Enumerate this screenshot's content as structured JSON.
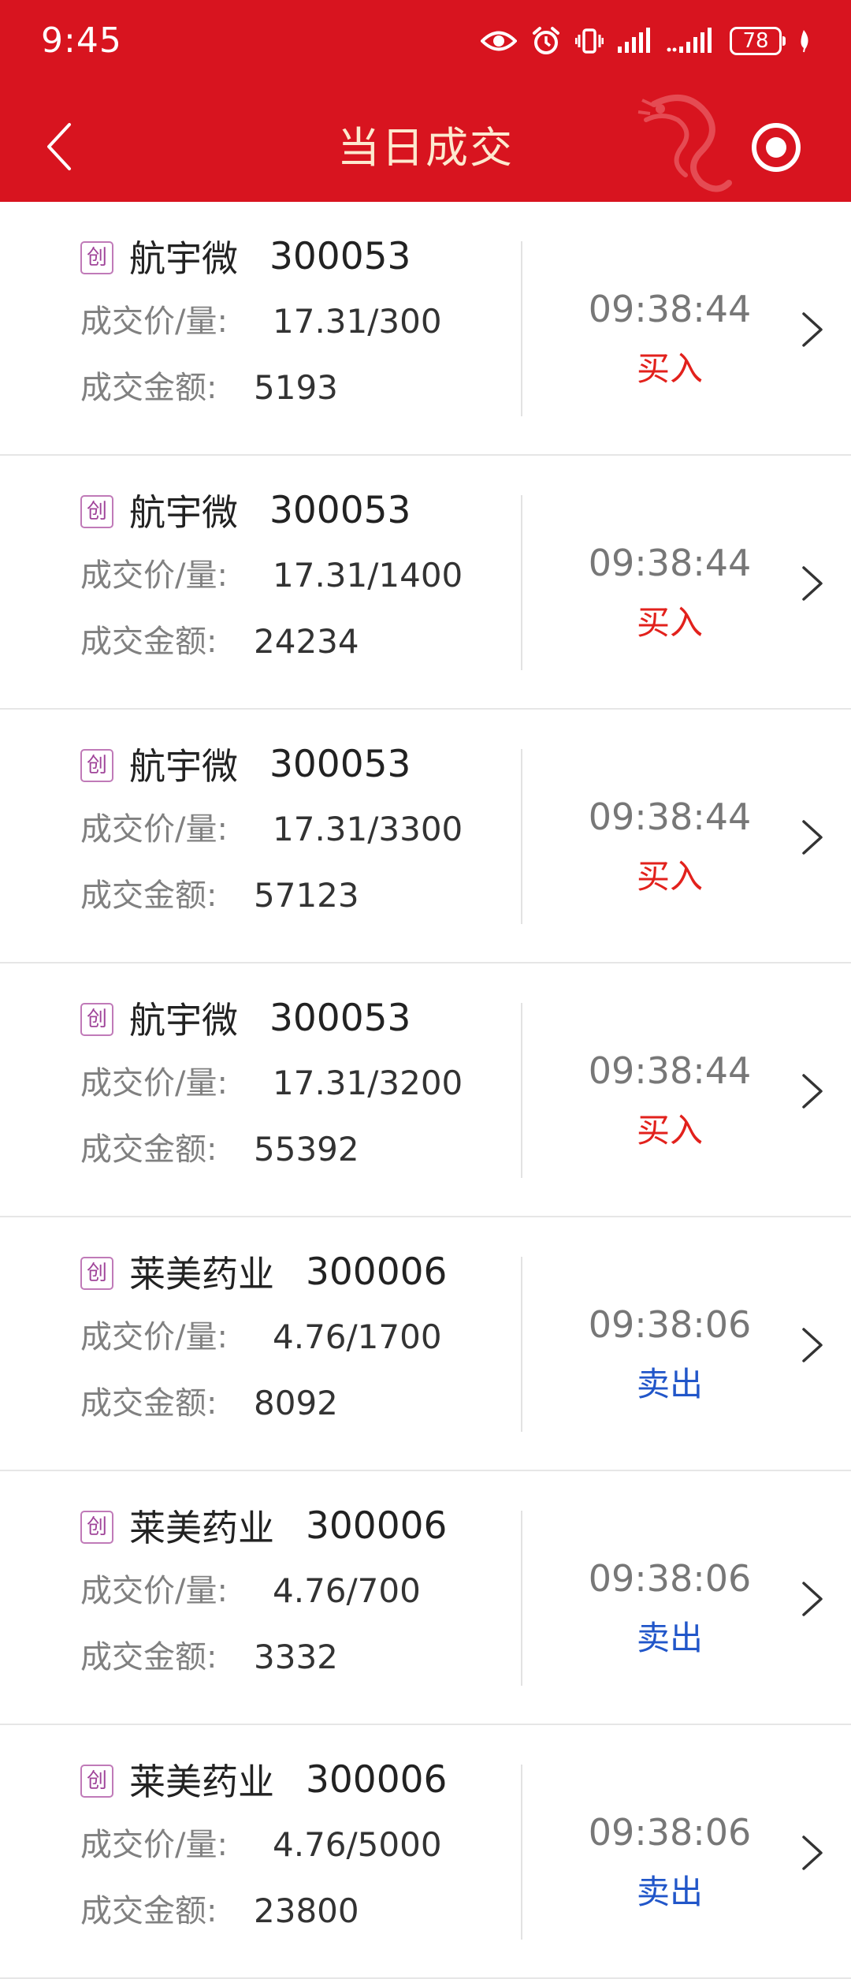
{
  "status_bar": {
    "time": "9:45",
    "battery": "78",
    "icons": [
      "eye-icon",
      "alarm-icon",
      "vibrate-icon",
      "signal-icon",
      "signal-icon",
      "battery-icon",
      "leaf-icon"
    ]
  },
  "header": {
    "title": "当日成交",
    "background_color": "#d8141f",
    "title_color": "#fde9cf"
  },
  "labels": {
    "price_qty": "成交价/量:",
    "amount": "成交金额:"
  },
  "colors": {
    "buy": "#e2211c",
    "sell": "#2156c9"
  },
  "trades": [
    {
      "badge": "创",
      "name": "航宇微",
      "code": "300053",
      "price_qty": "17.31/300",
      "amount": "5193",
      "time": "09:38:44",
      "side": "买入",
      "side_type": "buy"
    },
    {
      "badge": "创",
      "name": "航宇微",
      "code": "300053",
      "price_qty": "17.31/1400",
      "amount": "24234",
      "time": "09:38:44",
      "side": "买入",
      "side_type": "buy"
    },
    {
      "badge": "创",
      "name": "航宇微",
      "code": "300053",
      "price_qty": "17.31/3300",
      "amount": "57123",
      "time": "09:38:44",
      "side": "买入",
      "side_type": "buy"
    },
    {
      "badge": "创",
      "name": "航宇微",
      "code": "300053",
      "price_qty": "17.31/3200",
      "amount": "55392",
      "time": "09:38:44",
      "side": "买入",
      "side_type": "buy"
    },
    {
      "badge": "创",
      "name": "莱美药业",
      "code": "300006",
      "price_qty": "4.76/1700",
      "amount": "8092",
      "time": "09:38:06",
      "side": "卖出",
      "side_type": "sell"
    },
    {
      "badge": "创",
      "name": "莱美药业",
      "code": "300006",
      "price_qty": "4.76/700",
      "amount": "3332",
      "time": "09:38:06",
      "side": "卖出",
      "side_type": "sell"
    },
    {
      "badge": "创",
      "name": "莱美药业",
      "code": "300006",
      "price_qty": "4.76/5000",
      "amount": "23800",
      "time": "09:38:06",
      "side": "卖出",
      "side_type": "sell"
    }
  ]
}
